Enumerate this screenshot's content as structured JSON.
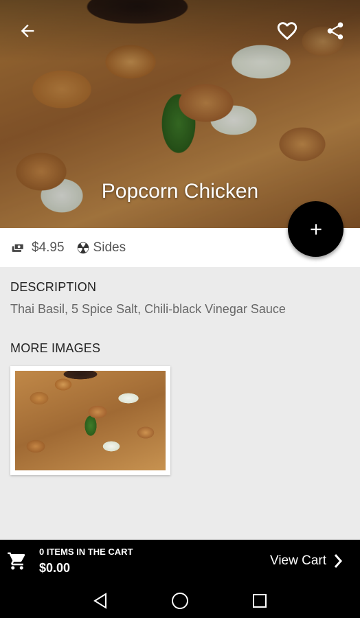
{
  "item": {
    "title": "Popcorn Chicken",
    "price": "$4.95",
    "category": "Sides"
  },
  "description": {
    "heading": "DESCRIPTION",
    "text": "Thai Basil, 5 Spice Salt, Chili-black Vinegar Sauce"
  },
  "more_images": {
    "heading": "MORE IMAGES"
  },
  "cart": {
    "items_label": "0 ITEMS IN THE CART",
    "total": "$0.00",
    "view_label": "View Cart"
  },
  "icons": {
    "back": "arrow-back-icon",
    "favorite": "heart-outline-icon",
    "share": "share-icon",
    "add": "plus-icon",
    "price": "money-icon",
    "category": "category-icon",
    "cart": "cart-icon",
    "view_cart": "chevron-right-icon",
    "nav_back": "nav-back-icon",
    "nav_home": "nav-home-icon",
    "nav_recent": "nav-recent-icon"
  },
  "colors": {
    "bar": "#000000",
    "fab": "#000000",
    "background": "#ebebeb"
  }
}
